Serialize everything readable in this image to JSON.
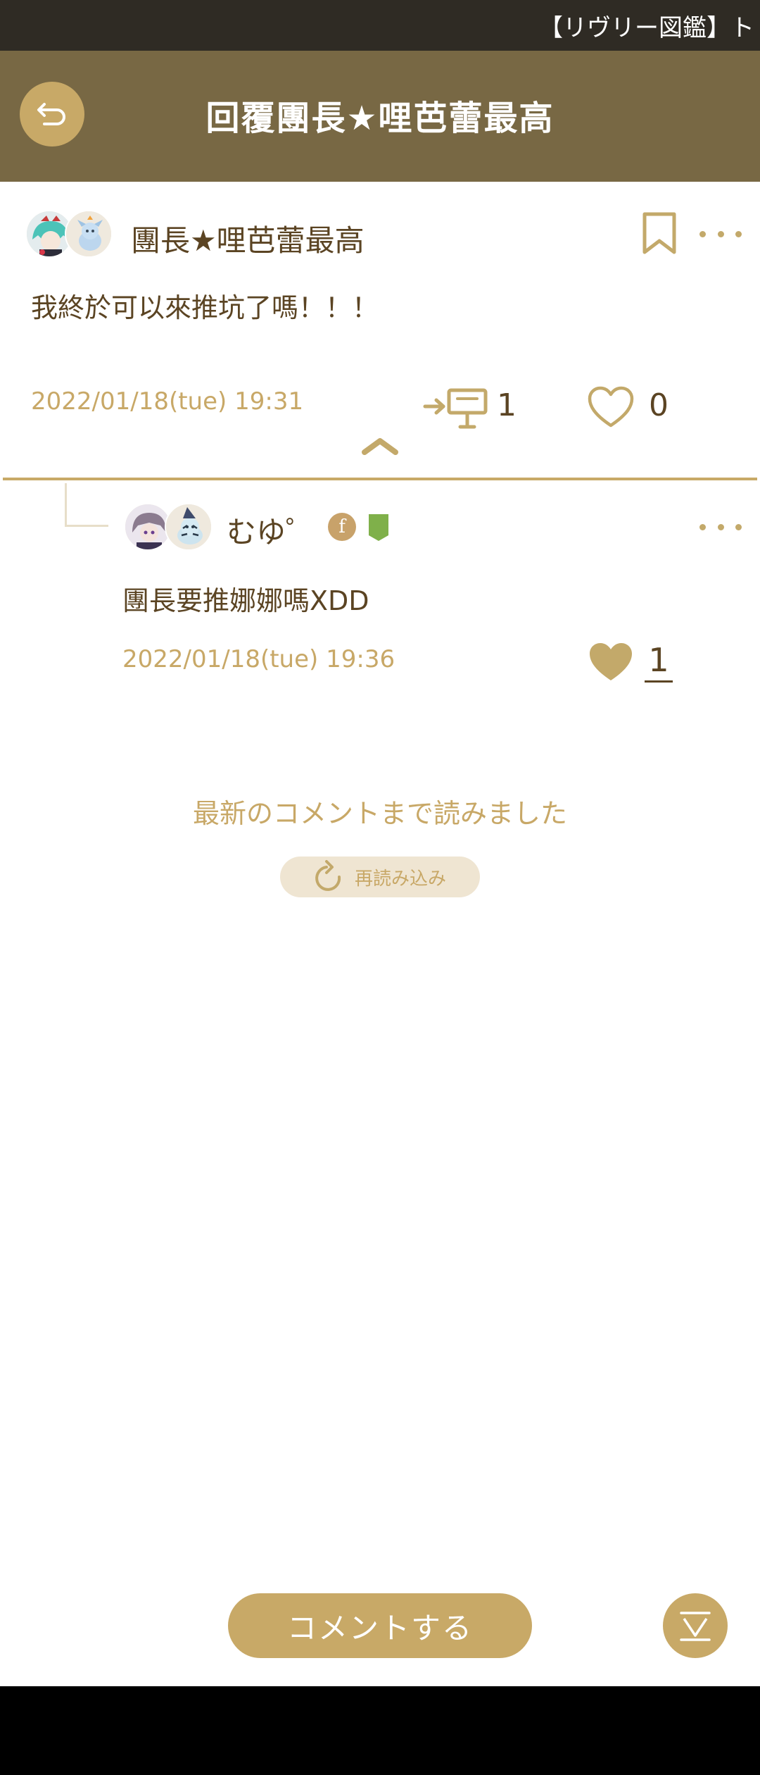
{
  "status_bar": {
    "text": "【リヴリー図鑑】ト"
  },
  "header": {
    "title": "回覆團長★哩芭蕾最高"
  },
  "post": {
    "author": "團長★哩芭蕾最高",
    "body": "我終於可以來推坑了嗎！！！",
    "date": "2022/01/18(tue) 19:31",
    "reply_count": "1",
    "like_count": "0"
  },
  "reply": {
    "author": "むゆ゜",
    "badge_letter": "f",
    "body": "團長要推娜娜嗎XDD",
    "date": "2022/01/18(tue) 19:36",
    "like_count": "1"
  },
  "footer": {
    "latest_note": "最新のコメントまで読みました",
    "reload_label": "再読み込み",
    "comment_button": "コメントする"
  },
  "colors": {
    "header_bg": "#786844",
    "accent": "#c8a967",
    "text": "#5b4423",
    "muted": "#c8a867"
  }
}
